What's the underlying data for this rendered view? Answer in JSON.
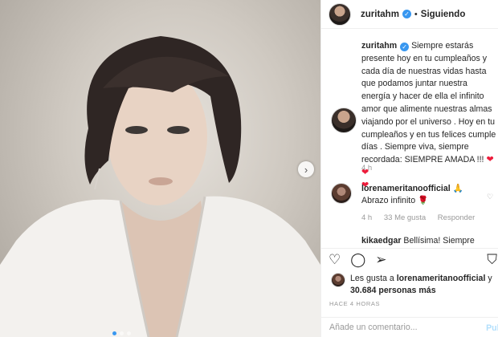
{
  "post": {
    "username": "zuritahm",
    "follow_status": "Siguiendo",
    "separator": "•"
  },
  "caption": {
    "username": "zuritahm",
    "text": "Siempre estarás presente hoy en tu cumpleaños y cada día de nuestras vidas hasta que podamos juntar nuestra energía y hacer de ella el infinito amor que alimente nuestras almas viajando por el universo . Hoy en tu cumpleaños y en tus felices cumple días . Siempre viva, siempre recordada: SIEMPRE AMADA !!! ",
    "hearts": "❤❤",
    "heart2": "❤",
    "time": "4 h"
  },
  "reply": {
    "username": "lorenameritanoofficial",
    "emoji": "🙏",
    "text": "Abrazo infinito ",
    "emoji2": "🌹",
    "time": "4 h",
    "likes": "33 Me gusta",
    "reply_label": "Responder"
  },
  "reply2": {
    "username": "kikaedgar",
    "text": "Bellísima! Siempre"
  },
  "likes": {
    "prefix": "Les gusta a ",
    "user": "lorenameritanoofficial",
    "middle": " y ",
    "count": "30.684 personas más"
  },
  "posted_time": "HACE 4 HORAS",
  "add_comment": {
    "placeholder": "Añade un comentario...",
    "publish_label": "Publi"
  },
  "icons": {
    "like": "heart-outline-icon",
    "comment": "comment-icon",
    "share": "share-icon",
    "save": "bookmark-icon",
    "next": "chevron-right-icon"
  },
  "colors": {
    "verified": "#3897f0",
    "heart": "#ed1c3b",
    "muted": "#999999",
    "publish": "#b2dffc"
  }
}
